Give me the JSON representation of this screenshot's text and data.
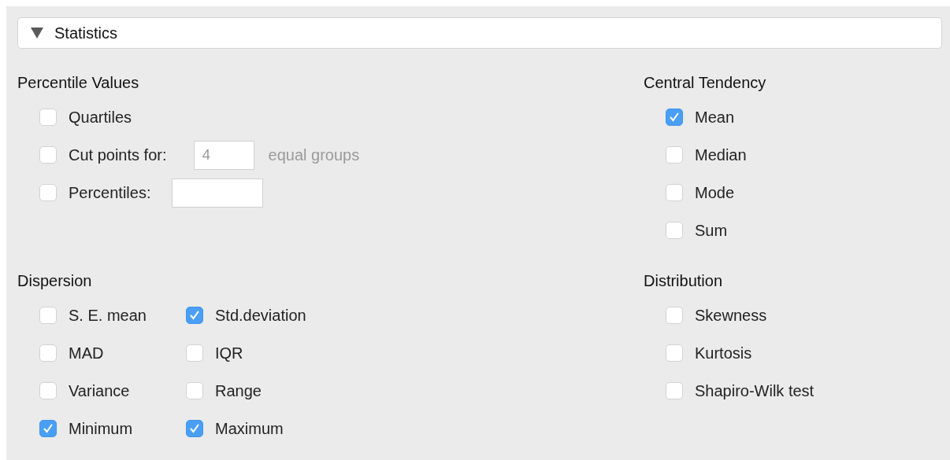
{
  "header": {
    "title": "Statistics",
    "expanded": true
  },
  "sections": [
    {
      "title": "Percentile Values",
      "kind": "list",
      "items": [
        {
          "kind": "checkbox",
          "label": "Quartiles",
          "checked": false
        },
        {
          "kind": "cut_points",
          "label": "Cut points for:",
          "checked": false,
          "field": {
            "value": "4",
            "disabled": true
          },
          "suffix": "equal groups"
        },
        {
          "kind": "percentiles",
          "label": "Percentiles:",
          "checked": false,
          "field": {
            "disabled": false
          }
        }
      ]
    },
    {
      "title": "Central Tendency",
      "kind": "list",
      "items": [
        {
          "kind": "checkbox",
          "label": "Mean",
          "checked": true
        },
        {
          "kind": "checkbox",
          "label": "Median",
          "checked": false
        },
        {
          "kind": "checkbox",
          "label": "Mode",
          "checked": false
        },
        {
          "kind": "checkbox",
          "label": "Sum",
          "checked": false
        }
      ]
    },
    {
      "title": "Dispersion",
      "kind": "grid",
      "items": [
        {
          "kind": "checkbox",
          "label": "S. E. mean",
          "checked": false
        },
        {
          "kind": "checkbox",
          "label": "Std.deviation",
          "checked": true
        },
        {
          "kind": "checkbox",
          "label": "MAD",
          "checked": false
        },
        {
          "kind": "checkbox",
          "label": "IQR",
          "checked": false
        },
        {
          "kind": "checkbox",
          "label": "Variance",
          "checked": false
        },
        {
          "kind": "checkbox",
          "label": "Range",
          "checked": false
        },
        {
          "kind": "checkbox",
          "label": "Minimum",
          "checked": true
        },
        {
          "kind": "checkbox",
          "label": "Maximum",
          "checked": true
        }
      ]
    },
    {
      "title": "Distribution",
      "kind": "list",
      "items": [
        {
          "kind": "checkbox",
          "label": "Skewness",
          "checked": false
        },
        {
          "kind": "checkbox",
          "label": "Kurtosis",
          "checked": false
        },
        {
          "kind": "checkbox",
          "label": "Shapiro-Wilk test",
          "checked": false
        }
      ]
    }
  ]
}
